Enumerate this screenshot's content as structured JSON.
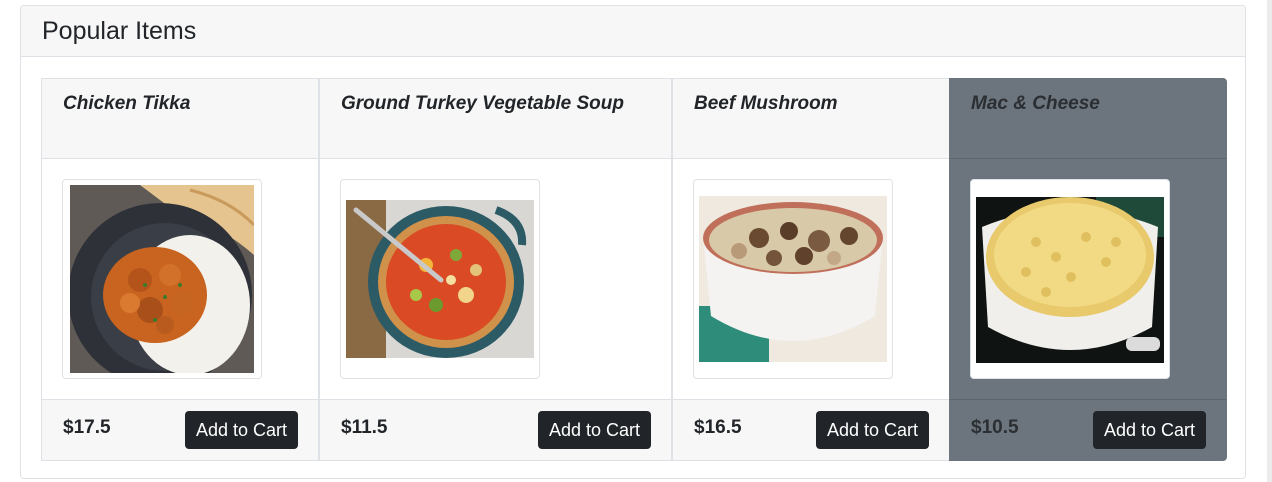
{
  "section": {
    "title": "Popular Items"
  },
  "items": [
    {
      "name": "Chicken Tikka",
      "price": "$17.5",
      "button": "Add to Cart",
      "image_icon": "chicken-tikka-dish-image"
    },
    {
      "name": "Ground Turkey Vegetable Soup",
      "price": "$11.5",
      "button": "Add to Cart",
      "image_icon": "vegetable-soup-pot-image"
    },
    {
      "name": "Beef Mushroom",
      "price": "$16.5",
      "button": "Add to Cart",
      "image_icon": "beef-mushroom-bowl-image"
    },
    {
      "name": "Mac & Cheese",
      "price": "$10.5",
      "button": "Add to Cart",
      "image_icon": "mac-and-cheese-dish-image"
    }
  ],
  "colors": {
    "dark_card": "#6c757d",
    "button": "#212529",
    "header_bg": "#f7f7f7"
  }
}
